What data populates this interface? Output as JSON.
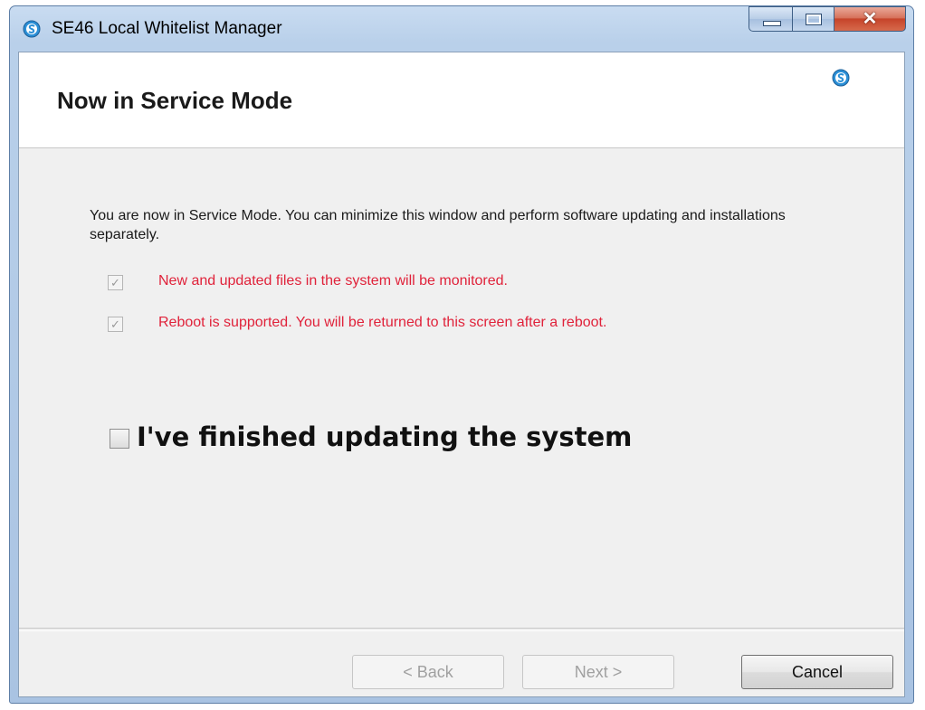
{
  "window": {
    "title": "SE46 Local Whitelist Manager",
    "icon": "shield-s-icon",
    "caption_buttons": {
      "minimize": "minimize-icon",
      "maximize": "maximize-icon",
      "close": "close-icon"
    }
  },
  "header": {
    "title": "Now in Service Mode",
    "icon": "shield-s-icon"
  },
  "body": {
    "intro": "You are now in Service Mode. You can minimize this window and perform software updating and installations separately.",
    "notes": [
      {
        "text": "New and updated files in the system will be monitored.",
        "checked": true,
        "disabled": true
      },
      {
        "text": "Reboot is supported. You will be returned to this screen after a reboot.",
        "checked": true,
        "disabled": true
      }
    ],
    "finished": {
      "label": "I've finished updating the system",
      "checked": false
    }
  },
  "footer": {
    "back_label": "< Back",
    "next_label": "Next >",
    "cancel_label": "Cancel"
  },
  "colors": {
    "note_text": "#e0223a",
    "client_bg": "#f0f0f0",
    "header_bg": "#ffffff",
    "icon_blue": "#2b8fd6"
  }
}
